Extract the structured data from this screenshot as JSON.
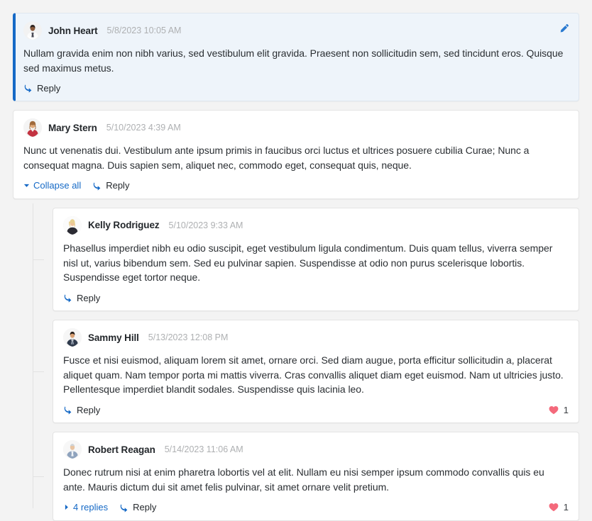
{
  "theme": {
    "accent": "#1569c6",
    "selected_bg": "#eef4fa",
    "page_bg": "#f3f3f3",
    "card_bg": "#ffffff",
    "heart_color": "#f4697b",
    "timestamp_color": "#aeb0b2"
  },
  "labels": {
    "reply": "Reply",
    "collapse_all": "Collapse all",
    "replies_4": "4 replies",
    "edit": "edit-icon"
  },
  "comments": [
    {
      "id": "john-heart",
      "author": "John Heart",
      "timestamp": "5/8/2023 10:05 AM",
      "text": "Nullam gravida enim non nibh varius, sed vestibulum elit gravida. Praesent non sollicitudin sem, sed tincidunt eros. Quisque sed maximus metus.",
      "selected": true,
      "has_edit_button": true,
      "actions": {
        "reply": "Reply"
      }
    },
    {
      "id": "mary-stern",
      "author": "Mary Stern",
      "timestamp": "5/10/2023 4:39 AM",
      "text": "Nunc ut venenatis dui. Vestibulum ante ipsum primis in faucibus orci luctus et ultrices posuere cubilia Curae; Nunc a consequat magna. Duis sapien sem, aliquet nec, commodo eget, consequat quis, neque.",
      "selected": false,
      "has_edit_button": false,
      "actions": {
        "collapse_all": "Collapse all",
        "reply": "Reply"
      }
    },
    {
      "id": "kelly-rodriguez",
      "author": "Kelly Rodriguez",
      "timestamp": "5/10/2023 9:33 AM",
      "text": "Phasellus imperdiet nibh eu odio suscipit, eget vestibulum ligula condimentum. Duis quam tellus, viverra semper nisl ut, varius bibendum sem. Sed eu pulvinar sapien. Suspendisse at odio non purus scelerisque lobortis. Suspendisse eget tortor neque.",
      "selected": false,
      "has_edit_button": false,
      "actions": {
        "reply": "Reply"
      }
    },
    {
      "id": "sammy-hill",
      "author": "Sammy Hill",
      "timestamp": "5/13/2023 12:08 PM",
      "text": "Fusce et nisi euismod, aliquam lorem sit amet, ornare orci. Sed diam augue, porta efficitur sollicitudin a, placerat aliquet quam. Nam tempor porta mi mattis viverra. Cras convallis aliquet diam eget euismod. Nam ut ultricies justo. Pellentesque imperdiet blandit sodales. Suspendisse quis lacinia leo.",
      "selected": false,
      "has_edit_button": false,
      "like_count": "1",
      "actions": {
        "reply": "Reply"
      }
    },
    {
      "id": "robert-reagan",
      "author": "Robert Reagan",
      "timestamp": "5/14/2023 11:06 AM",
      "text": "Donec rutrum nisi at enim pharetra lobortis vel at elit. Nullam eu nisi semper ipsum commodo convallis quis eu ante. Mauris dictum dui sit amet felis pulvinar, sit amet ornare velit pretium.",
      "selected": false,
      "has_edit_button": false,
      "like_count": "1",
      "actions": {
        "replies": "4 replies",
        "reply": "Reply"
      }
    }
  ]
}
